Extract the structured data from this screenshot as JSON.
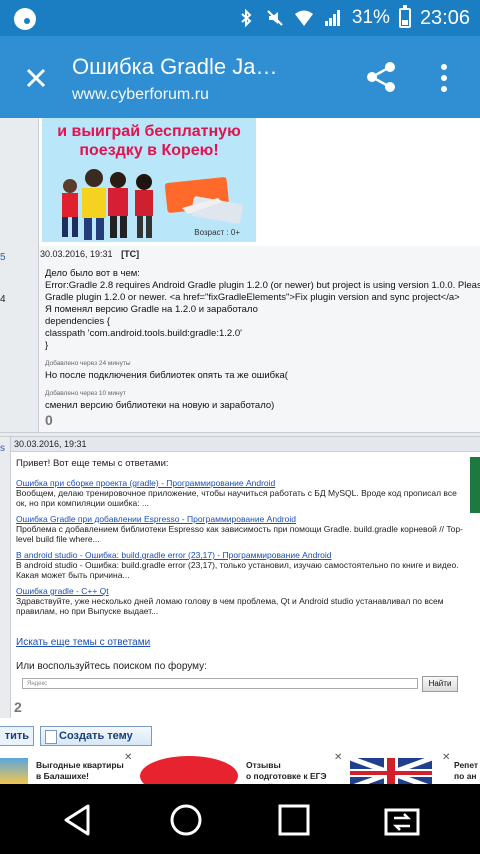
{
  "status_bar": {
    "battery_text": "31%",
    "battery_level": 0.31,
    "time": "23:06",
    "icons": [
      "notification-icon",
      "bluetooth-icon",
      "mute-icon",
      "wifi-icon",
      "signal-icon",
      "battery-icon"
    ]
  },
  "app_bar": {
    "title": "Ошибка Gradle Ja…",
    "url": "www.cyberforum.ru",
    "color": "#2f8fd2"
  },
  "ad_top": {
    "text_line1": "и выиграй бесплатную",
    "text_line2": "поездку в Корею!",
    "age": "Возраст : 0+"
  },
  "post1": {
    "left_marks": [
      "5",
      "4"
    ],
    "date": "30.03.2016, 19:31",
    "tag": "[ТС]",
    "lines": [
      "Дело было вот в чем:",
      "Error:Gradle 2.8 requires Android Gradle plugin 1.2.0 (or newer) but project is using version 1.0.0. Pleas",
      "Gradle plugin 1.2.0 or newer. <a href=\"fixGradleElements\">Fix plugin version and sync project</a>",
      "Я поменял версию Gradle на 1.2.0 и заработало",
      "dependencies {",
      "classpath 'com.android.tools.build:gradle:1.2.0'",
      "}"
    ],
    "note1": "Добавлено через 24 минуты",
    "line_after1": "Но после подключения библиотек опять та же ошибка(",
    "note2": "Добавлено через 10 минут",
    "line_after2": "сменил версию библиотеки на новую и заработало)",
    "rating": "0"
  },
  "post2": {
    "left_mark": "s",
    "date": "30.03.2016, 19:31",
    "intro": "Привет! Вот еще темы с ответами:",
    "related": [
      {
        "link": "Ошибка при сборке проекта (gradle) - Программирование Android",
        "desc": "Вообщем, делаю тренировочное приложение, чтобы научиться работать с БД MySQL. Вроде код прописал все ок, но при компиляции ошибка: ..."
      },
      {
        "link": "Ошибка Gradle при добавлении Espresso - Программирование Android",
        "desc": "Проблема с добавлением библиотеки Espresso как зависимость при помощи Gradle. build.gradle корневой // Top-level build file where..."
      },
      {
        "link": "В android studio - Ошибка: build.gradle error (23,17) - Программирование Android",
        "desc": "В android studio - Ошибка: build.gradle error (23,17), только установил, изучаю самостоятельно по книге и видео. Какая может быть причина..."
      },
      {
        "link": "Ошибка gradle - C++ Qt",
        "desc": "Здравствуйте, уже несколько дней ломаю голову в чем проблема, Qt и Android studio устанавливал по всем правилам, но при Выпуске выдает..."
      }
    ],
    "more_link": "Искать еще темы с ответами",
    "search_label": "Или воспользуйтесь поиском по форуму:",
    "search_placeholder": "Яндекс",
    "search_button": "Найти",
    "rating": "2"
  },
  "actions": {
    "reply": "тить",
    "create": "Создать тему"
  },
  "bottom_ads": [
    {
      "text": "Выгодные квартиры\nв Балашихе!"
    },
    {
      "text": "Отзывы\nо подготовке к ЕГЭ\nОнлайн..."
    },
    {
      "text": "Репет\nпо ан"
    }
  ],
  "nav_bar": {
    "buttons": [
      "back-icon",
      "home-icon",
      "recents-icon",
      "switch-icon"
    ]
  }
}
